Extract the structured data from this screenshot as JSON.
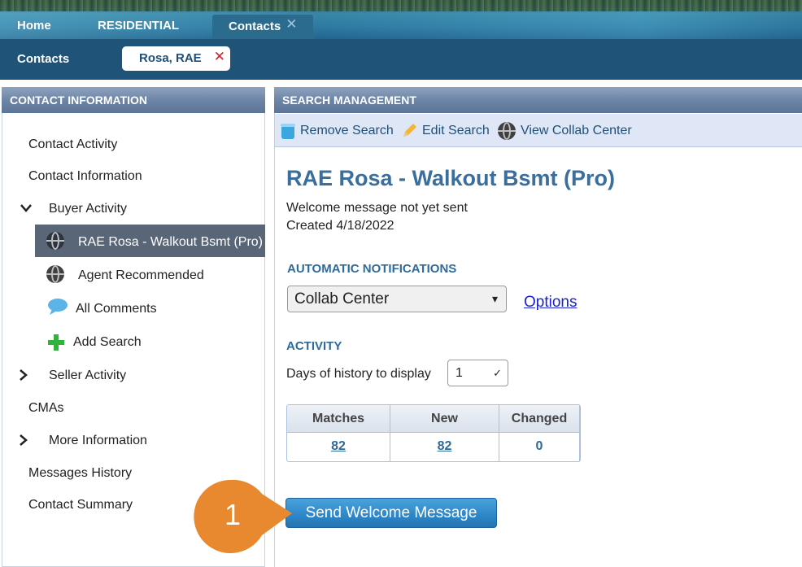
{
  "topnav": {
    "tabs": [
      {
        "label": "Home"
      },
      {
        "label": "RESIDENTIAL"
      },
      {
        "label": "Contacts",
        "close": "✕"
      }
    ]
  },
  "subnav": {
    "section_label": "Contacts",
    "contact_chip": {
      "label": "Rosa, RAE",
      "close": "✕"
    }
  },
  "left_panel": {
    "title": "CONTACT INFORMATION",
    "items": [
      {
        "label": "Contact Activity"
      },
      {
        "label": "Contact Information"
      },
      {
        "label": "Buyer Activity",
        "expanded": true
      },
      {
        "label": "RAE Rosa - Walkout Bsmt (Pro)",
        "selected": true,
        "icon": "globe-icon"
      },
      {
        "label": "Agent Recommended",
        "icon": "globe-icon"
      },
      {
        "label": "All Comments",
        "icon": "comment-icon"
      },
      {
        "label": "Add Search",
        "icon": "plus-icon"
      },
      {
        "label": "Seller Activity",
        "expanded": false
      },
      {
        "label": "CMAs"
      },
      {
        "label": "More Information",
        "expanded": false
      },
      {
        "label": "Messages History"
      },
      {
        "label": "Contact Summary"
      }
    ]
  },
  "right_panel": {
    "title": "SEARCH MANAGEMENT",
    "toolbar": {
      "remove": "Remove Search",
      "edit": "Edit Search",
      "collab": "View Collab Center"
    },
    "search_title": "RAE Rosa - Walkout Bsmt (Pro)",
    "welcome_status": "Welcome message not yet sent",
    "created": "Created 4/18/2022",
    "notifications": {
      "heading": "AUTOMATIC NOTIFICATIONS",
      "selected": "Collab Center",
      "options_link": "Options"
    },
    "activity": {
      "heading": "ACTIVITY",
      "days_label": "Days of history to display",
      "days_value": "1",
      "columns": [
        "Matches",
        "New",
        "Changed"
      ],
      "values": [
        "82",
        "82",
        "0"
      ]
    },
    "send_button": "Send Welcome Message"
  },
  "callout": {
    "number": "1",
    "color": "#e8892f"
  }
}
